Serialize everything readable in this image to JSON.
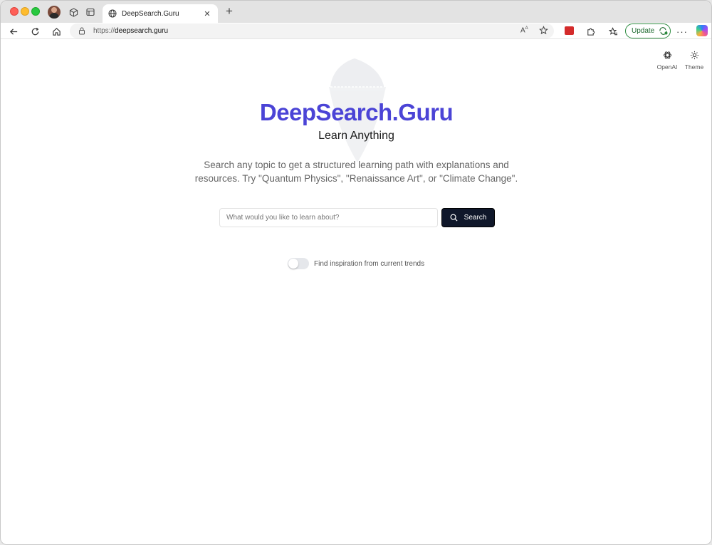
{
  "browser": {
    "tab": {
      "title": "DeepSearch.Guru",
      "close": "✕"
    },
    "new_tab": "+",
    "address": {
      "scheme": "https://",
      "host": "deepsearch.guru"
    },
    "update_label": "Update"
  },
  "header": {
    "model_button": {
      "label": "OpenAI",
      "icon": "openai-icon"
    },
    "theme_button": {
      "label": "Theme",
      "icon": "sun-icon"
    }
  },
  "hero": {
    "title": "DeepSearch.Guru",
    "subtitle": "Learn Anything",
    "description": "Search any topic to get a structured learning path with explanations and resources. Try \"Quantum Physics\", \"Renaissance Art\", or \"Climate Change\"."
  },
  "search": {
    "placeholder": "What would you like to learn about?",
    "value": "",
    "button_label": "Search"
  },
  "trends": {
    "label": "Find inspiration from current trends",
    "enabled": false
  },
  "colors": {
    "brand": "#4b44d6",
    "button_bg": "#0f172a",
    "update_border": "#2b8a3e"
  }
}
